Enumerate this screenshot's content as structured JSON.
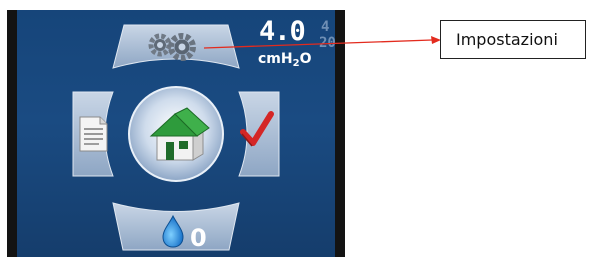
{
  "status": {
    "pressure_value": "4.0",
    "pressure_unit": "cmH",
    "pressure_unit_sub": "2",
    "pressure_unit_tail": "O",
    "side_value_top": "4",
    "side_value_bottom": "20"
  },
  "menu": {
    "settings_icon": "gears-icon",
    "reports_icon": "document-icon",
    "home_icon": "home-icon",
    "check_icon": "checkmark-icon",
    "humidifier_icon": "water-drop-icon",
    "humidifier_level": "0"
  },
  "callout": {
    "label": "Impostazioni",
    "arrow_color": "#e32b1e"
  },
  "colors": {
    "screen_bg": "#1a4b82",
    "panel": "#a7bad1",
    "house_roof": "#2e9b3c",
    "check": "#d42626"
  }
}
